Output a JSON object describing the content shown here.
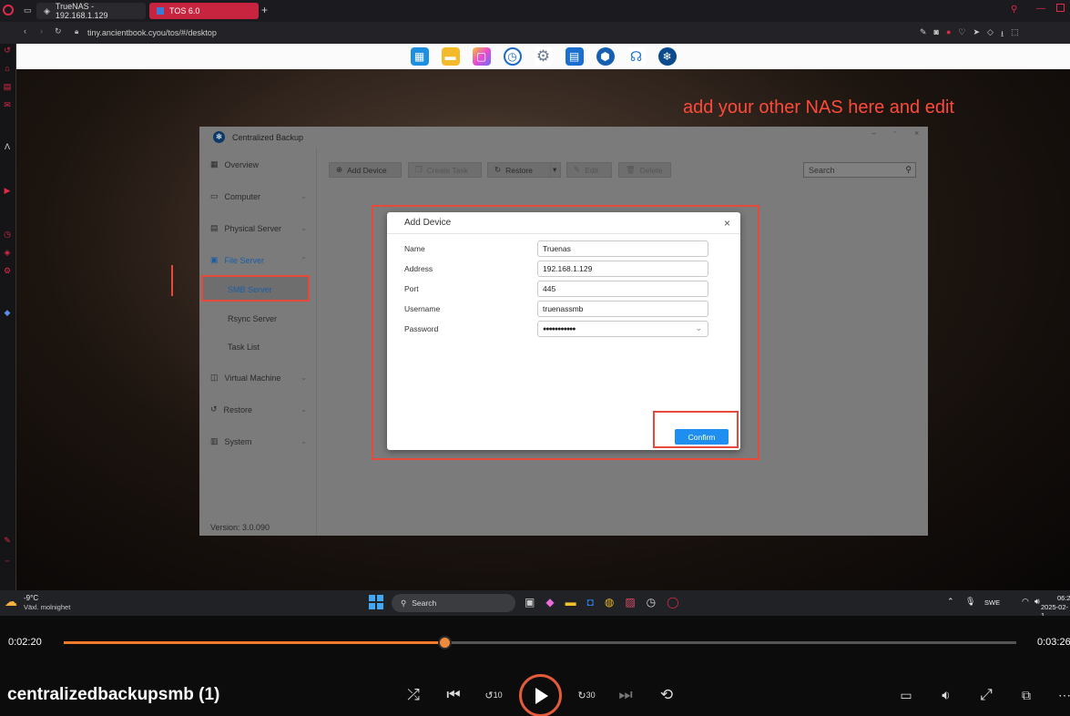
{
  "browser": {
    "tabs": [
      {
        "label": "TrueNAS - 192.168.1.129"
      },
      {
        "label": "TOS 6.0"
      }
    ],
    "url": "tiny.ancientbook.cyou/tos/#/desktop"
  },
  "annotation": {
    "text": "add your other NAS here and edit",
    "color": "#ff4a3a"
  },
  "app": {
    "title": "Centralized Backup",
    "version": "Version: 3.0.090",
    "sidebar": [
      {
        "label": "Overview",
        "icon": "grid-icon"
      },
      {
        "label": "Computer",
        "icon": "monitor-icon"
      },
      {
        "label": "Physical Server",
        "icon": "server-icon"
      },
      {
        "label": "File Server",
        "icon": "folder-icon"
      },
      {
        "label": "SMB Server"
      },
      {
        "label": "Rsync Server"
      },
      {
        "label": "Task List"
      },
      {
        "label": "Virtual Machine",
        "icon": "vm-icon"
      },
      {
        "label": "Restore",
        "icon": "restore-icon"
      },
      {
        "label": "System",
        "icon": "system-icon"
      }
    ],
    "toolbar": {
      "add_device": "Add Device",
      "create_task": "Create Task",
      "restore": "Restore",
      "edit": "Edit",
      "delete": "Delete",
      "search_placeholder": "Search"
    },
    "accent": "#1e8ef0"
  },
  "dialog": {
    "title": "Add Device",
    "fields": [
      {
        "label": "Name",
        "value": "Truenas"
      },
      {
        "label": "Address",
        "value": "192.168.1.129"
      },
      {
        "label": "Port",
        "value": "445"
      },
      {
        "label": "Username",
        "value": "truenassmb"
      },
      {
        "label": "Password",
        "value": "●●●●●●●●●●●"
      }
    ],
    "confirm": "Confirm"
  },
  "taskbar": {
    "weather_temp": "-9°C",
    "weather_desc": "Växl. molnighet",
    "search": "Search",
    "lang": "SWE",
    "time": "06:2",
    "date": "2025-02-1"
  },
  "player": {
    "current_time": "0:02:20",
    "total_time": "0:03:26",
    "progress": 0.4,
    "title": "centralizedbackupsmb (1)",
    "skip_back": "10",
    "skip_fwd": "30"
  }
}
